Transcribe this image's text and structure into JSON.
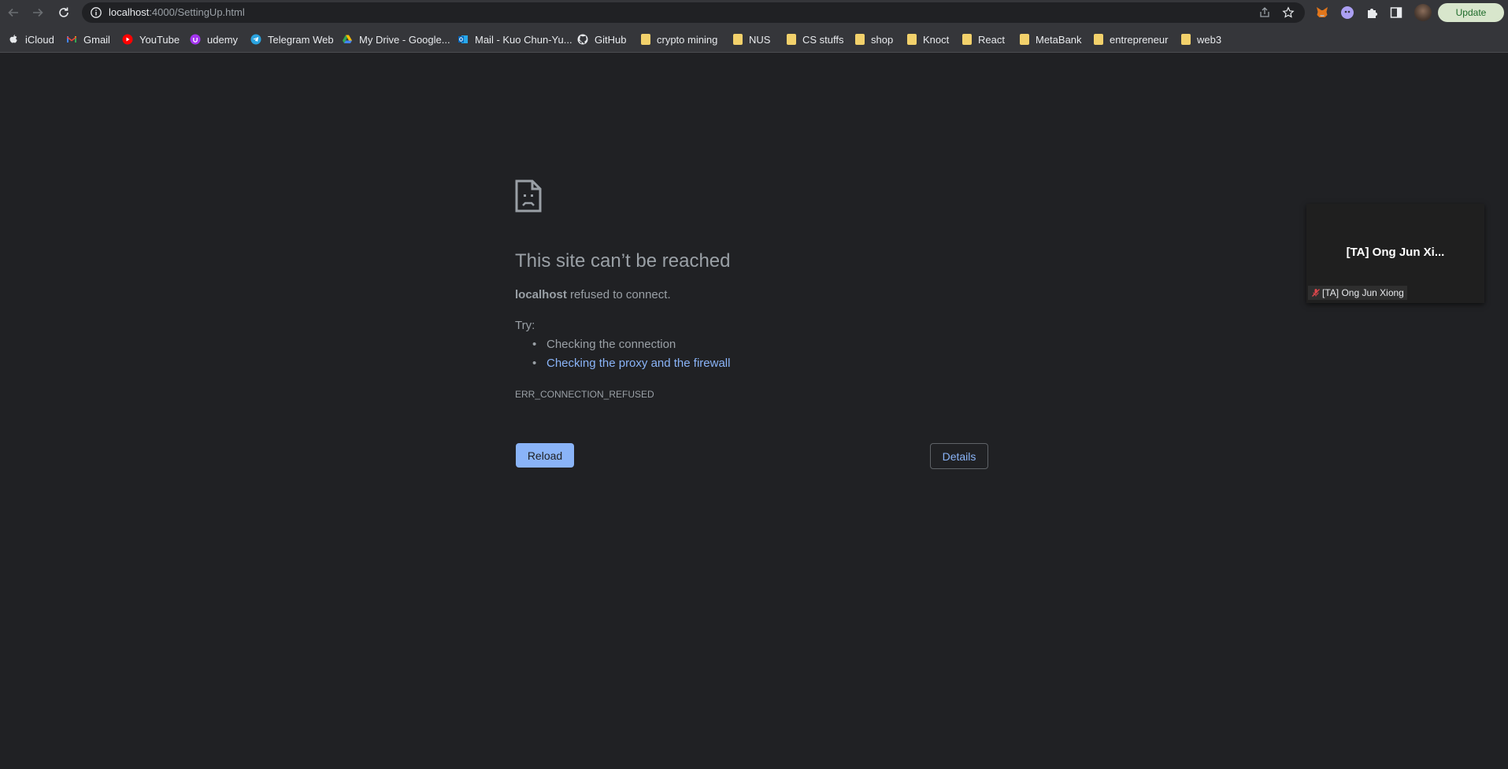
{
  "browser": {
    "url_host": "localhost",
    "url_path": ":4000/SettingUp.html",
    "update_label": "Update",
    "icons": {
      "back": "back-arrow-icon",
      "forward": "forward-arrow-icon",
      "reload": "reload-icon",
      "site_info": "info-icon",
      "share": "share-icon",
      "bookmark": "star-icon"
    },
    "extensions": [
      "metamask-fox-icon",
      "ghost-extension-icon",
      "puzzle-extensions-icon",
      "side-panel-icon"
    ]
  },
  "bookmarks": [
    {
      "label": "iCloud",
      "icon": "apple-icon"
    },
    {
      "label": "Gmail",
      "icon": "gmail-icon"
    },
    {
      "label": "YouTube",
      "icon": "youtube-icon"
    },
    {
      "label": "udemy",
      "icon": "udemy-icon"
    },
    {
      "label": "Telegram Web",
      "icon": "telegram-icon"
    },
    {
      "label": "My Drive - Google...",
      "icon": "google-drive-icon"
    },
    {
      "label": "Mail - Kuo Chun-Yu...",
      "icon": "outlook-icon"
    },
    {
      "label": "GitHub",
      "icon": "github-icon"
    },
    {
      "label": "crypto mining",
      "icon": "folder-icon"
    },
    {
      "label": "NUS",
      "icon": "folder-icon"
    },
    {
      "label": "CS stuffs",
      "icon": "folder-icon"
    },
    {
      "label": "shop",
      "icon": "folder-icon"
    },
    {
      "label": "Knoct",
      "icon": "folder-icon"
    },
    {
      "label": "React",
      "icon": "folder-icon"
    },
    {
      "label": "MetaBank",
      "icon": "folder-icon"
    },
    {
      "label": "entrepreneur",
      "icon": "folder-icon"
    },
    {
      "label": "web3",
      "icon": "folder-icon"
    }
  ],
  "error": {
    "title": "This site can’t be reached",
    "host": "localhost",
    "detail": " refused to connect.",
    "try_label": "Try:",
    "suggestions": [
      "Checking the connection",
      "Checking the proxy and the firewall"
    ],
    "code": "ERR_CONNECTION_REFUSED",
    "reload_label": "Reload",
    "details_label": "Details"
  },
  "video_tile": {
    "display_name": "[TA] Ong Jun Xi...",
    "label": "[TA] Ong Jun Xiong"
  }
}
